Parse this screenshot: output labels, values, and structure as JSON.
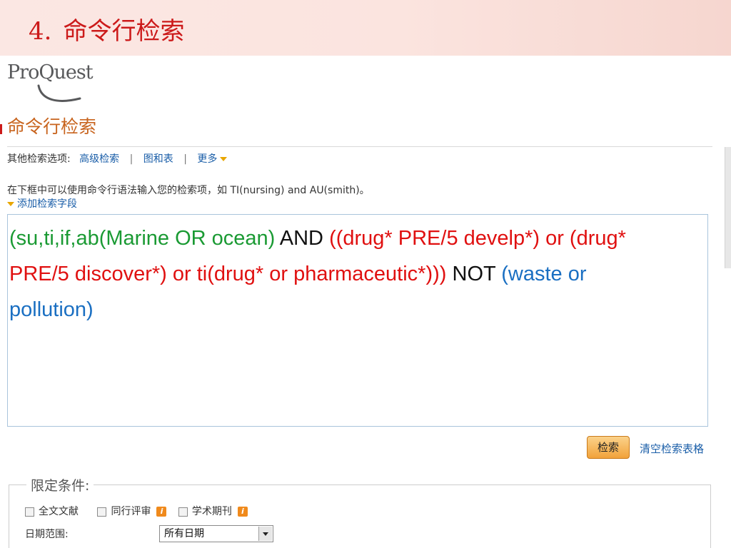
{
  "slide": {
    "number": "4.",
    "title": "命令行检索"
  },
  "app": {
    "logo_text": "ProQuest",
    "page_heading": "命令行检索"
  },
  "options": {
    "label": "其他检索选项:",
    "links": [
      "高级检索",
      "图和表",
      "更多"
    ],
    "separator": "|"
  },
  "hint": "在下框中可以使用命令行语法输入您的检索项，如 TI(nursing) and AU(smith)。",
  "add_field": "添加检索字段",
  "query": {
    "part1": "(su,ti,if,ab(Marine OR ocean)",
    "op1": " AND ",
    "part2": "((drug* PRE/5 develp*) or (drug* PRE/5 discover*) or ti(drug* or pharmaceutic*)))",
    "op2": " NOT ",
    "part3": "(waste or pollution)"
  },
  "actions": {
    "search": "检索",
    "clear": "清空检索表格"
  },
  "limits": {
    "legend": "限定条件:",
    "checkboxes": [
      "全文文献",
      "同行评审",
      "学术期刊"
    ],
    "date_label": "日期范围:",
    "date_value": "所有日期"
  },
  "colors": {
    "slide_title": "#cc1a1a",
    "heading": "#c8641e",
    "link": "#1a5ea8",
    "query_green": "#1a9a33",
    "query_red": "#e01010",
    "query_blue": "#1a6fc2"
  }
}
